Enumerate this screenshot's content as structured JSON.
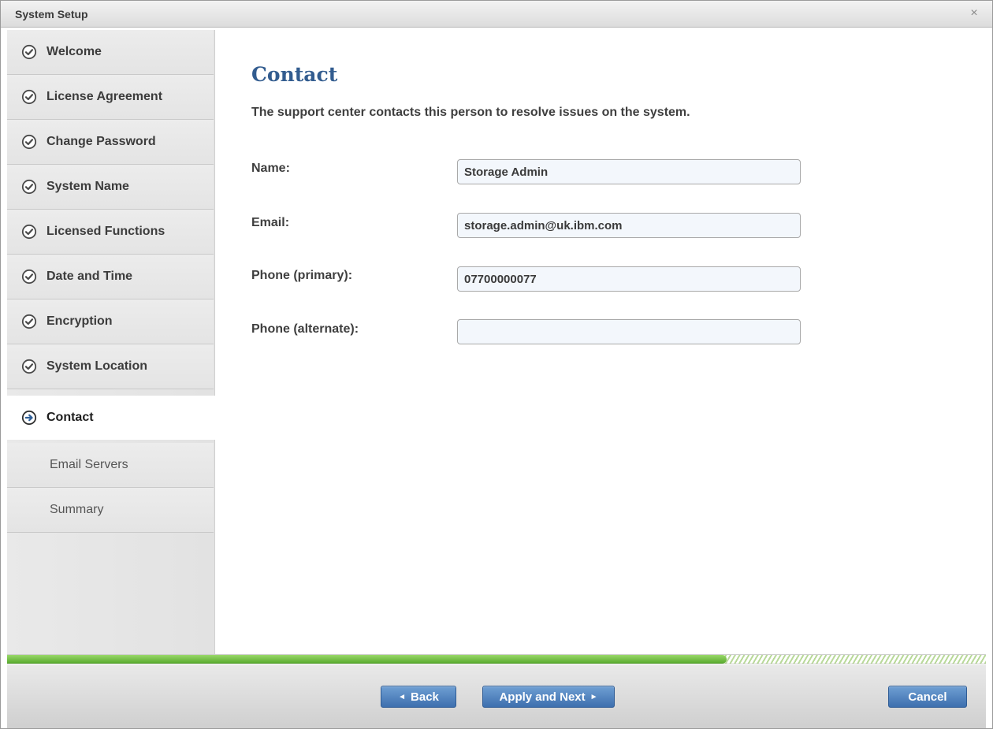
{
  "window": {
    "title": "System Setup",
    "close_glyph": "×"
  },
  "sidebar": {
    "items": [
      {
        "label": "Welcome",
        "state": "done",
        "icon": "check-circle-icon"
      },
      {
        "label": "License Agreement",
        "state": "done",
        "icon": "check-circle-icon"
      },
      {
        "label": "Change Password",
        "state": "done",
        "icon": "check-circle-icon"
      },
      {
        "label": "System Name",
        "state": "done",
        "icon": "check-circle-icon"
      },
      {
        "label": "Licensed Functions",
        "state": "done",
        "icon": "check-circle-icon"
      },
      {
        "label": "Date and Time",
        "state": "done",
        "icon": "check-circle-icon"
      },
      {
        "label": "Encryption",
        "state": "done",
        "icon": "check-circle-icon"
      },
      {
        "label": "System Location",
        "state": "done",
        "icon": "check-circle-icon"
      },
      {
        "label": "Contact",
        "state": "active",
        "icon": "arrow-circle-icon"
      },
      {
        "label": "Email Servers",
        "state": "pending"
      },
      {
        "label": "Summary",
        "state": "pending"
      }
    ]
  },
  "main": {
    "title": "Contact",
    "description": "The support center contacts this person to resolve issues on the system.",
    "fields": {
      "name": {
        "label": "Name:",
        "value": "Storage Admin"
      },
      "email": {
        "label": "Email:",
        "value": "storage.admin@uk.ibm.com"
      },
      "phone_primary": {
        "label": "Phone (primary):",
        "value": "07700000077"
      },
      "phone_alternate": {
        "label": "Phone (alternate):",
        "value": ""
      }
    }
  },
  "progress": {
    "fraction": 0.735
  },
  "footer": {
    "back_label": "Back",
    "apply_next_label": "Apply and Next",
    "cancel_label": "Cancel"
  },
  "colors": {
    "title_blue": "#325c8f",
    "button_blue": "#3d6fae",
    "progress_green": "#55a82b",
    "check_gray": "#4a4a4a",
    "active_arrow_blue": "#2f5f98"
  }
}
